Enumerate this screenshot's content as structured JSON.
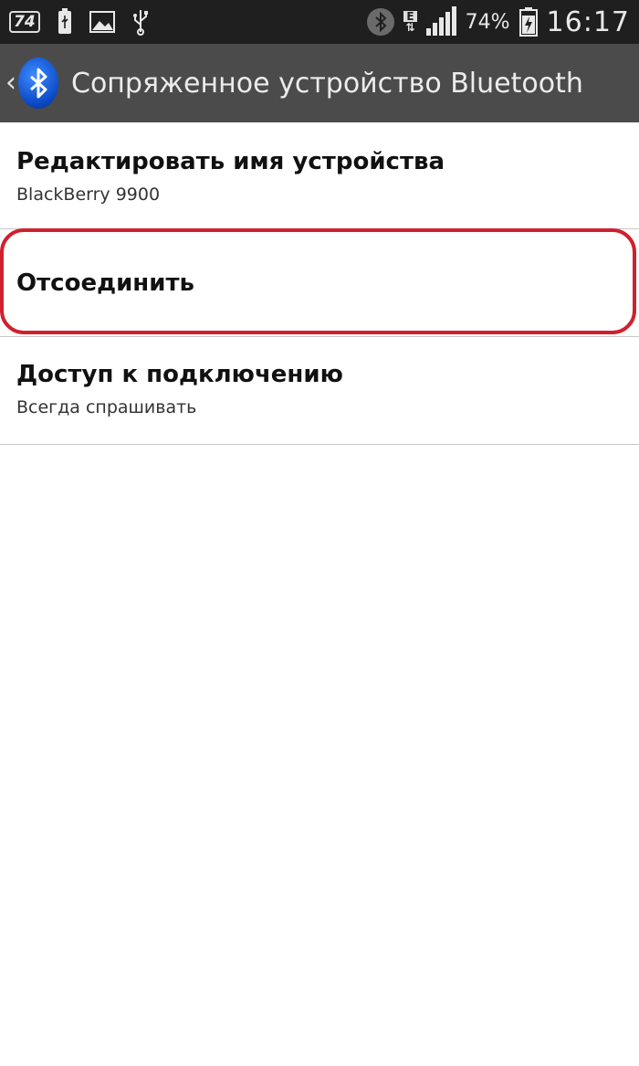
{
  "status_bar": {
    "notification_count": "74",
    "network_type": "E",
    "battery_percent": "74%",
    "time": "16:17",
    "icons": [
      "notification-icon",
      "usb-icon",
      "image-icon",
      "usb-debug-icon",
      "bluetooth-icon",
      "network-e-icon",
      "signal-icon",
      "battery-charging-icon"
    ]
  },
  "action_bar": {
    "title": "Сопряженное устройство Bluetooth",
    "back_icon": "chevron-left-icon",
    "logo_icon": "bluetooth-icon"
  },
  "list": {
    "items": [
      {
        "primary": "Редактировать имя устройства",
        "secondary": "BlackBerry 9900"
      },
      {
        "primary": "Отсоединить"
      },
      {
        "primary": "Доступ к подключению",
        "secondary": "Всегда спрашивать"
      }
    ]
  },
  "colors": {
    "status_bar": "#1f1f1f",
    "action_bar": "#4b4b4b",
    "highlight": "#d0202e",
    "bluetooth_blue": "#0a47c4"
  }
}
